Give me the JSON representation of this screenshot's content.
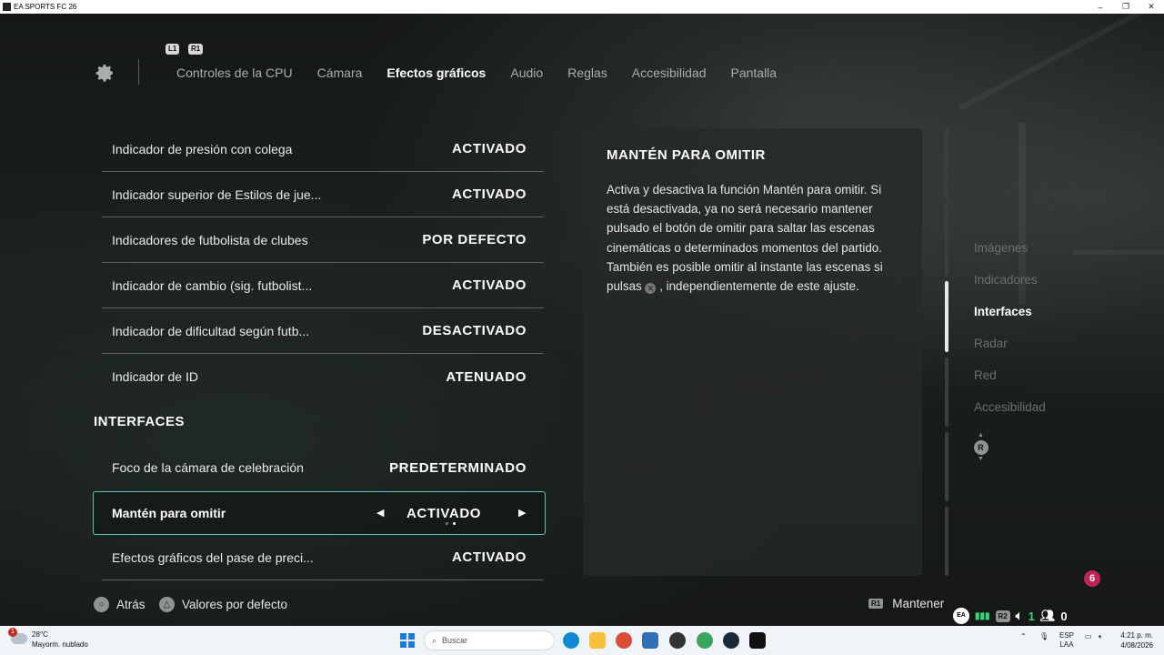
{
  "window": {
    "title": "EA SPORTS FC 26",
    "controls": [
      "–",
      "❐",
      "✕"
    ]
  },
  "nav": {
    "shoulder_left": "L1",
    "shoulder_right": "R1",
    "tabs": [
      {
        "label": "Controles de la CPU"
      },
      {
        "label": "Cámara"
      },
      {
        "label": "Efectos gráficos"
      },
      {
        "label": "Audio"
      },
      {
        "label": "Reglas"
      },
      {
        "label": "Accesibilidad"
      },
      {
        "label": "Pantalla"
      }
    ],
    "active_tab": "Efectos gráficos"
  },
  "settings": {
    "rows": [
      {
        "label": "Indicador de presión con colega",
        "value": "ACTIVADO"
      },
      {
        "label": "Indicador superior de Estilos de jue...",
        "value": "ACTIVADO"
      },
      {
        "label": "Indicadores de futbolista de clubes",
        "value": "POR DEFECTO"
      },
      {
        "label": "Indicador de cambio (sig. futbolist...",
        "value": "ACTIVADO"
      },
      {
        "label": "Indicador de dificultad según futb...",
        "value": "DESACTIVADO"
      },
      {
        "label": "Indicador de ID",
        "value": "ATENUADO"
      }
    ],
    "section_heading": "INTERFACES",
    "rows2": [
      {
        "label": "Foco de la cámara de celebración",
        "value": "PREDETERMINADO"
      }
    ],
    "selected": {
      "label": "Mantén para omitir",
      "value": "ACTIVADO",
      "option_index": 2,
      "option_count": 2
    },
    "rows3": [
      {
        "label": "Efectos gráficos del pase de preci...",
        "value": "ACTIVADO"
      }
    ]
  },
  "description": {
    "title": "MANTÉN PARA OMITIR",
    "paragraph1": "Activa y desactiva la función Mantén para omitir. Si está desactivada, ya no será necesario mantener pulsado el botón de omitir para saltar las escenas cinemáticas o determinados momentos del partido.",
    "paragraph2_before": "También es posible omitir al instante las escenas si pulsas",
    "paragraph2_after": ", independientemente de este ajuste."
  },
  "section_nav": {
    "items": [
      "Imágenes",
      "Indicadores",
      "Interfaces",
      "Radar",
      "Red",
      "Accesibilidad"
    ],
    "active": "Interfaces",
    "stick_label": "R"
  },
  "footer": {
    "back_label": "Atrás",
    "defaults_label": "Valores por defecto",
    "hold_glyph": "R1",
    "hold_label": "Mantener",
    "ea_badge": "EA",
    "r2_glyph": "R2",
    "voice_count": "1",
    "party_count": "0",
    "notification_count": "6"
  },
  "taskbar": {
    "weather_temp": "28°C",
    "weather_desc": "Mayorm. nublado",
    "weather_alert": "1",
    "search_placeholder": "Buscar",
    "lang_top": "ESP",
    "lang_bottom": "LAA",
    "time": "4:21 p. m.",
    "date": "4/08/2026"
  },
  "colors": {
    "accent_selected": "#54c7b8",
    "notification": "#c2245a",
    "network_green": "#3bd27a"
  }
}
